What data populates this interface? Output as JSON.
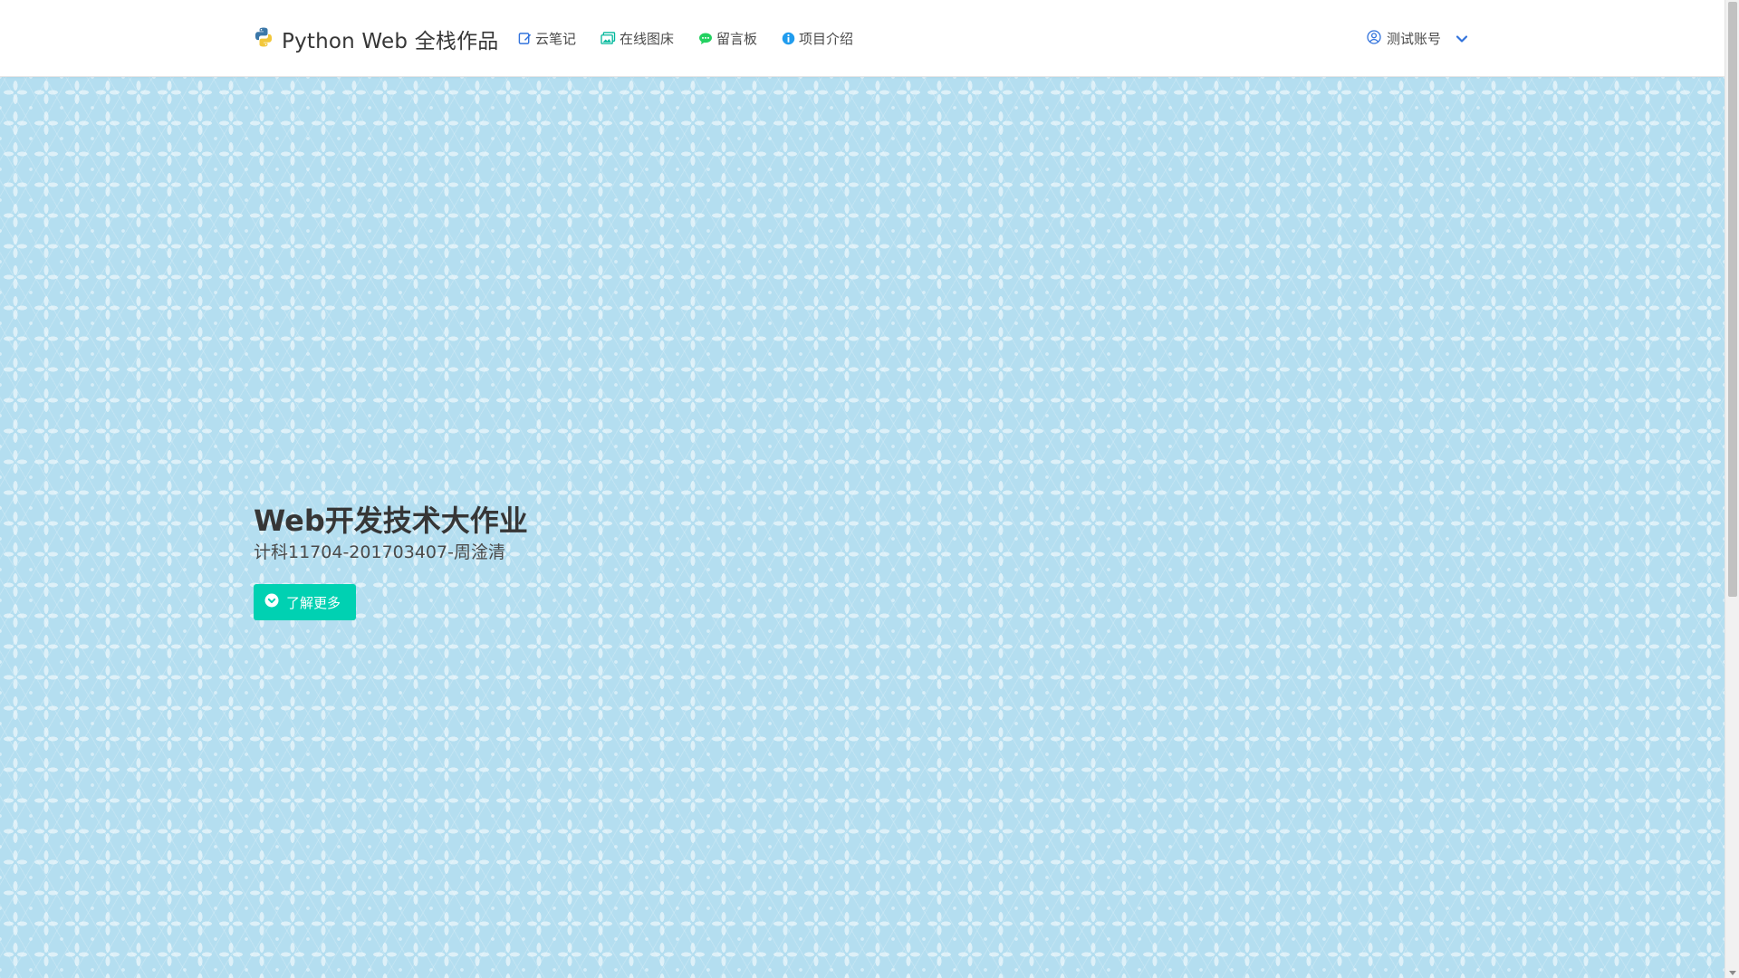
{
  "navbar": {
    "brand": {
      "title": "Python Web 全栈作品",
      "icon": "python-logo-icon"
    },
    "items": [
      {
        "label": "云笔记",
        "icon": "note-edit-icon",
        "color": "#3273dc"
      },
      {
        "label": "在线图床",
        "icon": "images-icon",
        "color": "#00b89c"
      },
      {
        "label": "留言板",
        "icon": "chat-bubble-icon",
        "color": "#23d160"
      },
      {
        "label": "项目介绍",
        "icon": "info-circle-icon",
        "color": "#209cee"
      }
    ],
    "account": {
      "label": "测试账号",
      "icon": "user-circle-icon",
      "dropdown_icon": "chevron-down-icon",
      "color": "#3273dc"
    }
  },
  "hero": {
    "title": "Web开发技术大作业",
    "subtitle": "计科11704-201703407-周淦清",
    "button_label": "了解更多",
    "button_icon": "chevron-circle-down-icon",
    "button_color": "#00d1b2",
    "background_color": "#b4def0"
  }
}
